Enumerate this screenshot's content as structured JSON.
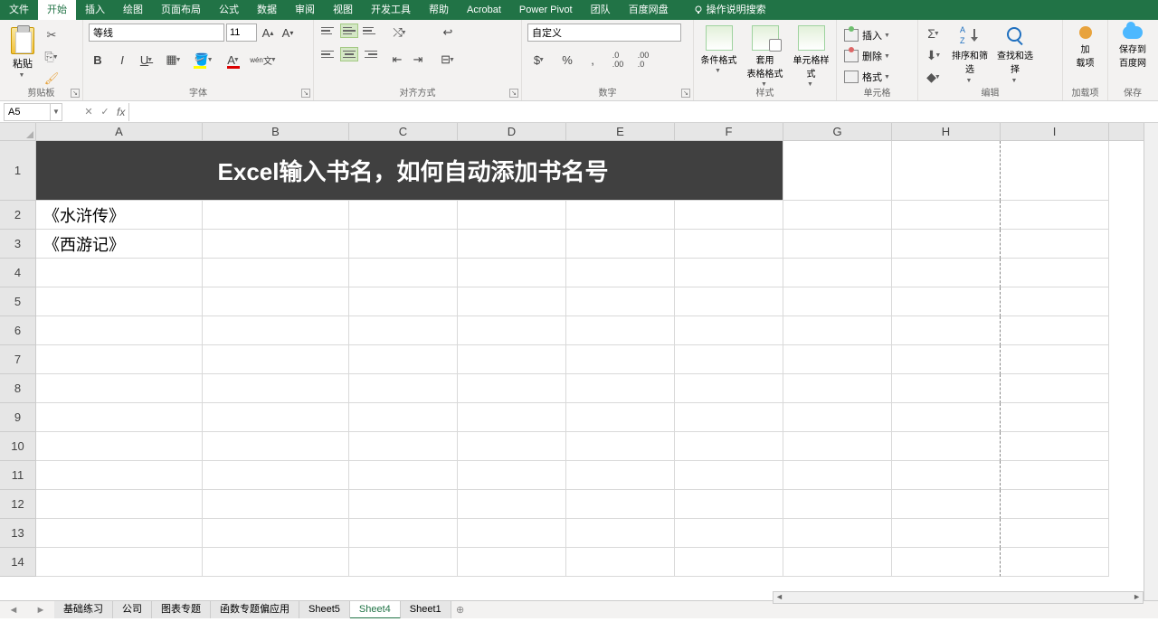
{
  "tabs": {
    "file": "文件",
    "home": "开始",
    "insert": "插入",
    "draw": "绘图",
    "layout": "页面布局",
    "formulas": "公式",
    "data": "数据",
    "review": "审阅",
    "view": "视图",
    "dev": "开发工具",
    "help": "帮助",
    "acrobat": "Acrobat",
    "powerpivot": "Power Pivot",
    "team": "团队",
    "baidu": "百度网盘",
    "tell": "操作说明搜索"
  },
  "ribbon": {
    "clipboard": {
      "label": "剪贴板",
      "paste": "粘贴"
    },
    "font": {
      "label": "字体",
      "name": "等线",
      "size": "11"
    },
    "alignment": {
      "label": "对齐方式"
    },
    "number": {
      "label": "数字",
      "format": "自定义"
    },
    "styles": {
      "label": "样式",
      "cond": "条件格式",
      "table": "套用\n表格格式",
      "cell": "单元格样式"
    },
    "cells": {
      "label": "单元格",
      "insert": "插入",
      "delete": "删除",
      "format": "格式"
    },
    "editing": {
      "label": "编辑",
      "sort": "排序和筛选",
      "find": "查找和选择"
    },
    "addins": {
      "label": "加载项",
      "btn": "加\n载项"
    },
    "save": {
      "label": "保存",
      "btn": "保存到\n百度网"
    }
  },
  "fx": {
    "namebox": "A5"
  },
  "columns": [
    "A",
    "B",
    "C",
    "D",
    "E",
    "F",
    "G",
    "H",
    "I"
  ],
  "rows": [
    "1",
    "2",
    "3",
    "4",
    "5",
    "6",
    "7",
    "8",
    "9",
    "10",
    "11",
    "12",
    "13",
    "14"
  ],
  "cells": {
    "banner": "Excel输入书名，如何自动添加书名号",
    "A2": "《水浒传》",
    "A3": "《西游记》"
  },
  "sheets": {
    "tabs": [
      "基础练习",
      "公司",
      "图表专题",
      "函数专题偏应用",
      "Sheet5",
      "Sheet4",
      "Sheet1"
    ],
    "active": "Sheet4"
  }
}
